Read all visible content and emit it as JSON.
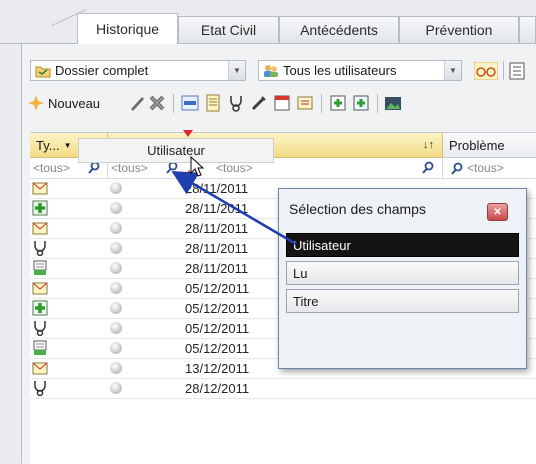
{
  "tabs": [
    {
      "label": "Historique",
      "active": true
    },
    {
      "label": "Etat Civil",
      "active": false
    },
    {
      "label": "Antécédents",
      "active": false
    },
    {
      "label": "Prévention",
      "active": false
    }
  ],
  "toolbar1": {
    "dossier_combo": "Dossier complet",
    "users_combo": "Tous les utilisateurs"
  },
  "toolbar2": {
    "new_label": "Nouveau"
  },
  "grid": {
    "columns": {
      "type": "Ty...",
      "utilisateur": "Utilisateur",
      "probleme": "Problème"
    },
    "filters": {
      "type": "<tous>",
      "date": "<tous>",
      "utilisateur": "<tous>",
      "probleme": "<tous>"
    },
    "rows": [
      {
        "icon": "mail-icon",
        "date": "28/11/2011"
      },
      {
        "icon": "add-doc-icon",
        "date": "28/11/2011"
      },
      {
        "icon": "mail-icon",
        "date": "28/11/2011"
      },
      {
        "icon": "stethoscope-icon",
        "date": "28/11/2011"
      },
      {
        "icon": "report-icon",
        "date": "28/11/2011"
      },
      {
        "icon": "mail-icon",
        "date": "05/12/2011"
      },
      {
        "icon": "add-doc-icon",
        "date": "05/12/2011"
      },
      {
        "icon": "stethoscope-icon",
        "date": "05/12/2011"
      },
      {
        "icon": "report-icon",
        "date": "05/12/2011"
      },
      {
        "icon": "mail-icon",
        "date": "13/12/2011"
      },
      {
        "icon": "stethoscope-icon",
        "date": "28/12/2011"
      }
    ]
  },
  "drag_ghost": "Utilisateur",
  "field_chooser": {
    "title": "Sélection des champs",
    "items": [
      "Utilisateur",
      "Lu",
      "Titre"
    ],
    "selected": "Utilisateur"
  },
  "colors": {
    "accent_header": "#f2dc84",
    "drag_marker": "#e0262a",
    "selected_item": "#141414",
    "arrow": "#1f3fb0"
  }
}
